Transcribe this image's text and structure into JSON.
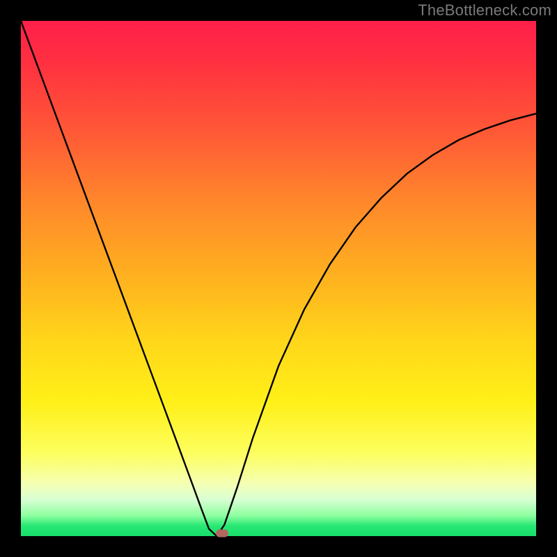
{
  "watermark": "TheBottleneck.com",
  "chart_data": {
    "type": "line",
    "title": "",
    "xlabel": "",
    "ylabel": "",
    "xlim": [
      0,
      1
    ],
    "ylim": [
      0,
      1
    ],
    "series": [
      {
        "name": "curve",
        "x": [
          0.0,
          0.05,
          0.1,
          0.15,
          0.2,
          0.25,
          0.3,
          0.325,
          0.35,
          0.365,
          0.38,
          0.395,
          0.42,
          0.45,
          0.5,
          0.55,
          0.6,
          0.65,
          0.7,
          0.75,
          0.8,
          0.85,
          0.9,
          0.95,
          1.0
        ],
        "y": [
          1.0,
          0.865,
          0.73,
          0.595,
          0.46,
          0.325,
          0.19,
          0.122,
          0.054,
          0.014,
          0.0,
          0.022,
          0.095,
          0.19,
          0.33,
          0.44,
          0.528,
          0.6,
          0.657,
          0.704,
          0.74,
          0.769,
          0.79,
          0.807,
          0.82
        ]
      }
    ],
    "marker": {
      "x": 0.39,
      "y": 0.005
    },
    "background_gradient": {
      "top": "#ff1f4b",
      "mid": "#ffd61a",
      "bottom": "#18de6a"
    }
  }
}
